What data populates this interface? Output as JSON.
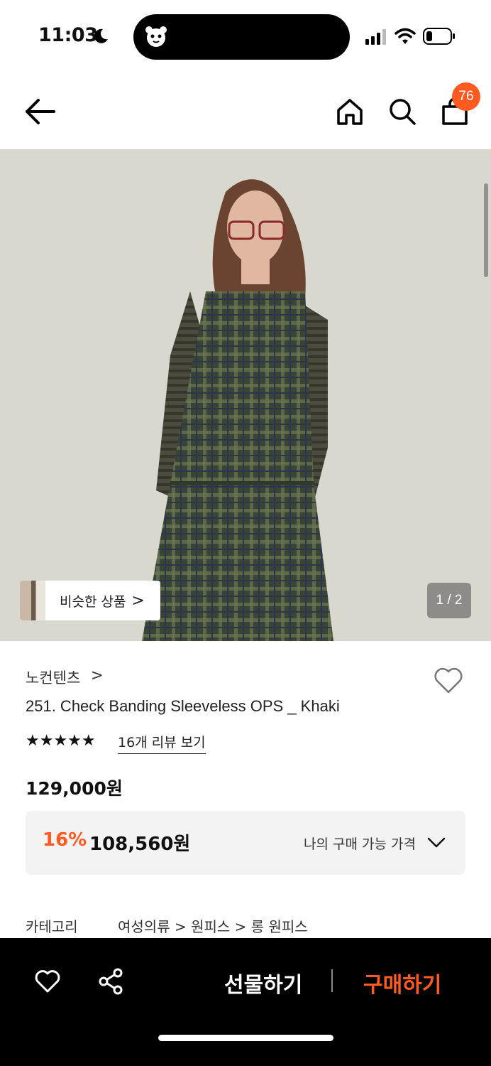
{
  "status_bar": {
    "time": "11:03"
  },
  "nav": {
    "cart_count": "76"
  },
  "gallery": {
    "similar_label": "비슷한 상품",
    "similar_chevron": ">",
    "page_counter": "1 / 2"
  },
  "product": {
    "brand": "노컨텐츠",
    "brand_chevron": ">",
    "title": "251. Check Banding Sleeveless OPS _ Khaki",
    "rating_stars": "★★★★★",
    "rating_value": 5,
    "review_link": "16개 리뷰 보기",
    "original_price": "129,000원",
    "discount_rate": "16%",
    "sale_price": "108,560원",
    "my_price_label": "나의 구매 가능 가격",
    "category_label": "카테고리",
    "category_path": "여성의류 > 원피스 > 롱 원피스"
  },
  "bottom_bar": {
    "gift_label": "선물하기",
    "buy_label": "구매하기"
  },
  "colors": {
    "accent": "#ff5a1f",
    "bar": "#000000"
  },
  "icons": [
    "moon-icon",
    "signal-icon",
    "wifi-icon",
    "battery-icon",
    "back-arrow-icon",
    "home-icon",
    "search-icon",
    "bag-icon",
    "heart-icon",
    "share-icon",
    "chevron-down-icon"
  ]
}
